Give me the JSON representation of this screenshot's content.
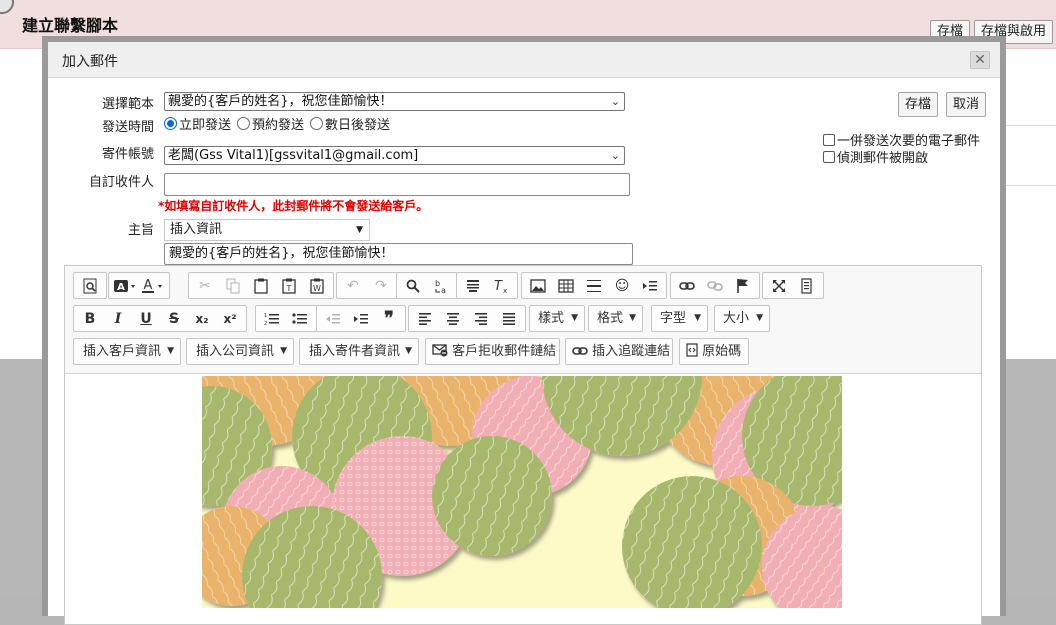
{
  "page": {
    "title": "建立聯繫腳本",
    "save_label": "存檔",
    "save_enable_label": "存檔與啟用"
  },
  "dialog": {
    "title": "加入郵件",
    "close_symbol": "✕",
    "save_label": "存檔",
    "cancel_label": "取消",
    "template": {
      "label": "選擇範本",
      "value": "親愛的{客戶的姓名}，祝您佳節愉快！"
    },
    "send_time": {
      "label": "發送時間",
      "options": [
        "立即發送",
        "預約發送",
        "數日後發送"
      ],
      "selected": "立即發送"
    },
    "sender": {
      "label": "寄件帳號",
      "value": "老闆(Gss Vital1)[gssvital1@gmail.com]"
    },
    "custom_recipient": {
      "label": "自訂收件人",
      "value": "",
      "warning": "*如填寫自訂收件人，此封郵件將不會發送給客戶。"
    },
    "subject": {
      "label": "主旨",
      "insert_info_label": "插入資訊",
      "value": "親愛的{客戶的姓名}，祝您佳節愉快！"
    },
    "options": {
      "send_secondary": "一併發送次要的電子郵件",
      "track_open": "偵測郵件被開啟"
    }
  },
  "editor": {
    "row1_icons": [
      [
        "preview-icon"
      ],
      [
        "bg-color-icon",
        "text-color-icon"
      ],
      [
        "cut-icon",
        "copy-icon",
        "paste-icon",
        "paste-text-icon",
        "paste-word-icon"
      ],
      [
        "undo-icon",
        "redo-icon"
      ],
      [
        "find-icon",
        "replace-icon"
      ],
      [
        "select-all-icon",
        "remove-format-icon"
      ],
      [
        "image-icon",
        "table-icon",
        "horizontal-rule-icon",
        "smiley-icon",
        "page-break-icon"
      ],
      [
        "link-icon",
        "unlink-icon",
        "anchor-icon"
      ],
      [
        "maximize-icon",
        "show-blocks-icon"
      ]
    ],
    "row2_format": [
      "B",
      "I",
      "U",
      "S",
      "x₂",
      "x²"
    ],
    "dropdowns": [
      "樣式",
      "格式",
      "字型",
      "大小"
    ],
    "insert_buttons": {
      "customer": "插入客戶資訊",
      "company": "插入公司資訊",
      "sender": "插入寄件者資訊",
      "unsubscribe": "客戶拒收郵件鏈結",
      "tracking": "插入追蹤連結",
      "source": "原始碼"
    }
  },
  "colors": {
    "header_bg": "#f1dede",
    "dialog_border": "#9a9a9a",
    "warning_red": "#e00000",
    "art_green": "#a7b86c",
    "art_orange": "#e9b36c",
    "art_pink": "#f1aeb5",
    "art_cream": "#fdfac8"
  }
}
